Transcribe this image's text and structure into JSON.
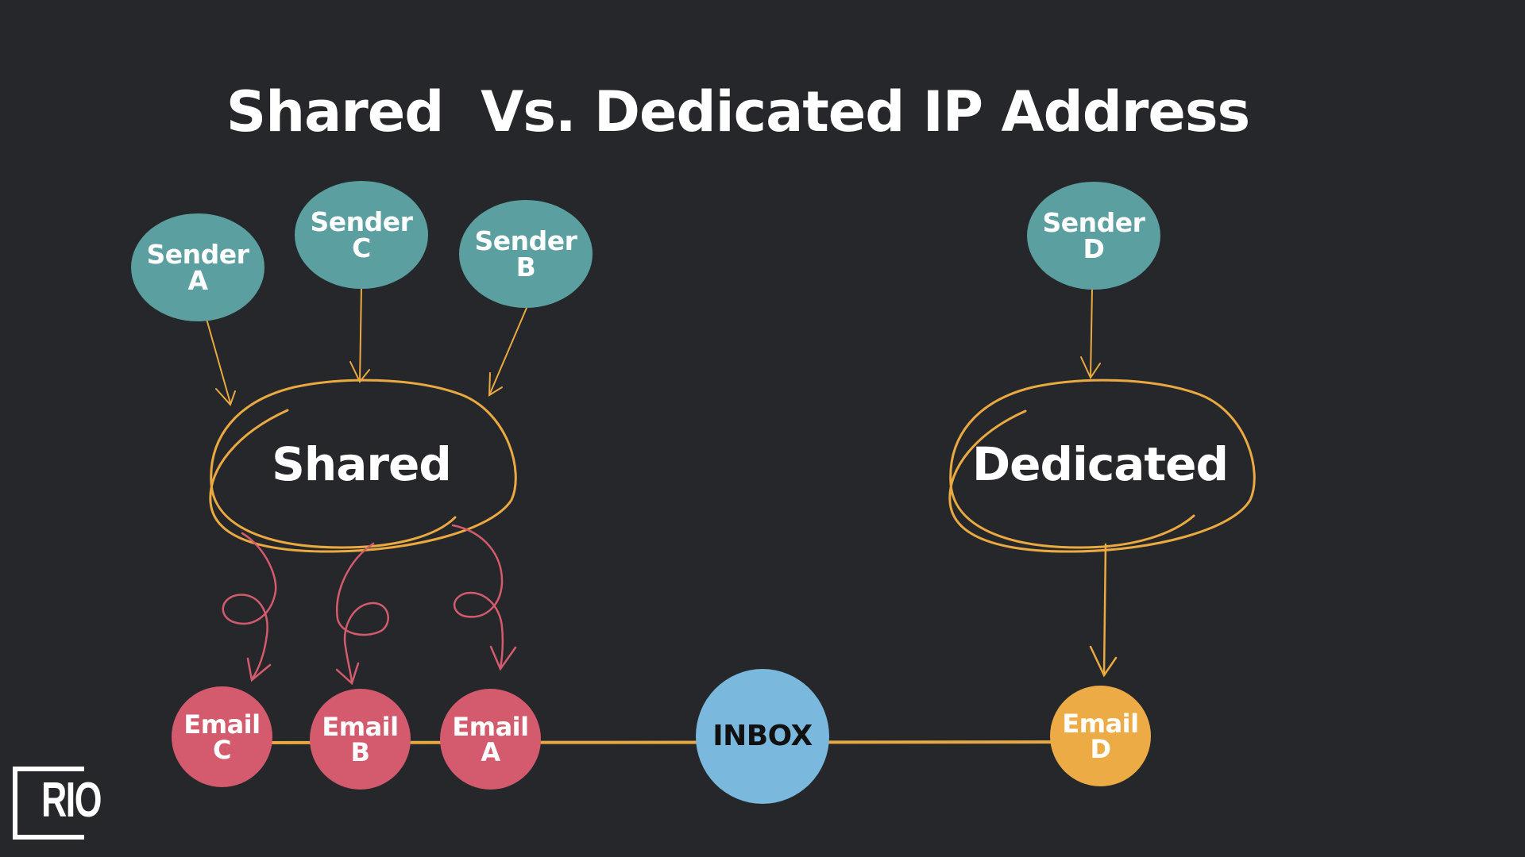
{
  "title": "Shared  Vs. Dedicated IP Address",
  "colors": {
    "background": "#26272a",
    "sender": "#5b9fa0",
    "email_shared": "#d35b6d",
    "email_dedicated": "#ecab45",
    "inbox": "#7bb8de",
    "connector": "#e8a942",
    "shared_arrows": "#d35b6d"
  },
  "senders": [
    {
      "id": "A",
      "line1": "Sender",
      "line2": "A"
    },
    {
      "id": "C",
      "line1": "Sender",
      "line2": "C"
    },
    {
      "id": "B",
      "line1": "Sender",
      "line2": "B"
    },
    {
      "id": "D",
      "line1": "Sender",
      "line2": "D"
    }
  ],
  "pools": {
    "shared": "Shared",
    "dedicated": "Dedicated"
  },
  "emails": [
    {
      "id": "C",
      "line1": "Email",
      "line2": "C"
    },
    {
      "id": "B",
      "line1": "Email",
      "line2": "B"
    },
    {
      "id": "A",
      "line1": "Email",
      "line2": "A"
    },
    {
      "id": "D",
      "line1": "Email",
      "line2": "D"
    }
  ],
  "inbox": "INBOX",
  "logo": {
    "text": "RIO",
    "icon": "bracket-logo-icon"
  }
}
